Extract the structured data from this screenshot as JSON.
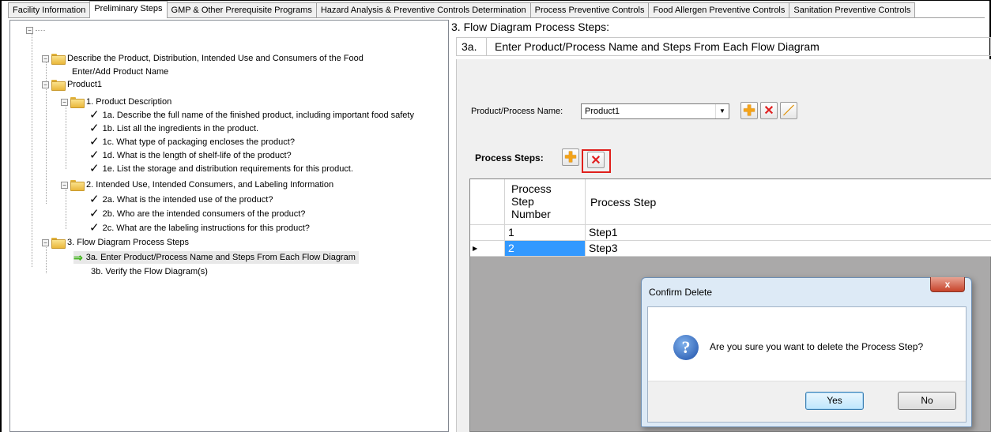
{
  "tabs": [
    {
      "label": "Facility Information",
      "active": false
    },
    {
      "label": "Preliminary Steps",
      "active": true
    },
    {
      "label": "GMP & Other Prerequisite Programs",
      "active": false
    },
    {
      "label": "Hazard Analysis & Preventive Controls Determination",
      "active": false
    },
    {
      "label": "Process Preventive Controls",
      "active": false
    },
    {
      "label": "Food Allergen Preventive Controls",
      "active": false
    },
    {
      "label": "Sanitation Preventive Controls",
      "active": false
    }
  ],
  "tree": {
    "describe": "Describe the Product, Distribution, Intended Use and Consumers of the Food",
    "enter_add": "Enter/Add Product Name",
    "product1": "Product1",
    "product_description": "1. Product Description",
    "q1a": "1a. Describe the full name of the finished product, including important food safety",
    "q1b": "1b. List all the ingredients in the product.",
    "q1c": "1c. What type of packaging encloses the product?",
    "q1d": "1d. What is the length of shelf-life of the product?",
    "q1e": "1e. List the storage and distribution requirements for this product.",
    "intended_use": "2. Intended Use, Intended Consumers, and Labeling Information",
    "q2a": "2a. What is the intended use of the product?",
    "q2b": "2b. Who are the intended consumers of the product?",
    "q2c": "2c. What are the labeling instructions for this product?",
    "flow": "3. Flow Diagram Process Steps",
    "q3a": "3a. Enter Product/Process Name and Steps From Each Flow Diagram",
    "q3b": "3b. Verify the Flow Diagram(s)",
    "check_icon": "check-icon",
    "arrow_icon": "arrow-right-icon"
  },
  "main": {
    "heading": "3. Flow Diagram Process Steps:",
    "step_num": "3a.",
    "step_title": "Enter Product/Process Name and Steps From Each Flow Diagram",
    "product_label": "Product/Process Name:",
    "product_value": "Product1",
    "process_steps_label": "Process Steps:",
    "grid": {
      "columns": [
        "Process Step Number",
        "Process Step"
      ],
      "col1_lines": [
        "Process",
        "Step",
        "Number"
      ],
      "rows": [
        {
          "number": "1",
          "step": "Step1",
          "selected": false
        },
        {
          "number": "2",
          "step": "Step3",
          "selected": true
        }
      ]
    }
  },
  "dialog": {
    "title": "Confirm Delete",
    "close_glyph": "x",
    "message": "Are you sure you want to delete the Process Step?",
    "yes": "Yes",
    "no": "No",
    "icon": "question-icon"
  },
  "colors": {
    "highlight_box": "#e0201c",
    "selected_row": "#3399ff",
    "arrow": "#3fb419"
  }
}
